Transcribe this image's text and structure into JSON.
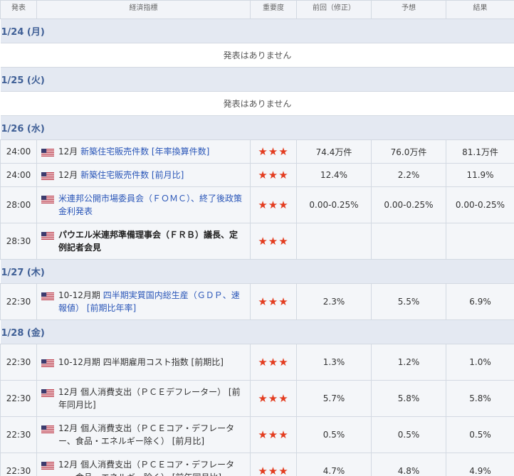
{
  "header": {
    "time": "発表",
    "indicator": "経済指標",
    "importance": "重要度",
    "previous": "前回（修正）",
    "forecast": "予想",
    "result": "結果"
  },
  "colors": {
    "accent_link": "#2a56b8",
    "date_bar": "#e4e9f2",
    "star": "#e33c1f"
  },
  "no_data_text": "発表はありません",
  "sections": [
    {
      "date": "1/24 (月)",
      "events": []
    },
    {
      "date": "1/25 (火)",
      "events": []
    },
    {
      "date": "1/26 (水)",
      "events": [
        {
          "time": "24:00",
          "period": "12月",
          "name": "新築住宅販売件数 [年率換算件数]",
          "style": "link",
          "importance": 3,
          "stars": "★★★",
          "previous": "74.4万件",
          "forecast": "76.0万件",
          "result": "81.1万件"
        },
        {
          "time": "24:00",
          "period": "12月",
          "name": "新築住宅販売件数 [前月比]",
          "style": "link",
          "importance": 3,
          "stars": "★★★",
          "previous": "12.4%",
          "forecast": "2.2%",
          "result": "11.9%"
        },
        {
          "time": "28:00",
          "period": "",
          "name": "米連邦公開市場委員会（ＦＯＭＣ）、終了後政策金利発表",
          "style": "link",
          "importance": 3,
          "stars": "★★★",
          "previous": "0.00-0.25%",
          "forecast": "0.00-0.25%",
          "result": "0.00-0.25%"
        },
        {
          "time": "28:30",
          "period": "",
          "name": "パウエル米連邦準備理事会（ＦＲＢ）議長、定例記者会見",
          "style": "bold",
          "importance": 3,
          "stars": "★★★",
          "previous": "",
          "forecast": "",
          "result": ""
        }
      ]
    },
    {
      "date": "1/27 (木)",
      "events": [
        {
          "time": "22:30",
          "period": "10-12月期",
          "name": "四半期実質国内総生産（ＧＤＰ、速報値） [前期比年率]",
          "style": "link",
          "importance": 3,
          "stars": "★★★",
          "previous": "2.3%",
          "forecast": "5.5%",
          "result": "6.9%"
        }
      ]
    },
    {
      "date": "1/28 (金)",
      "events": [
        {
          "time": "22:30",
          "period": "10-12月期",
          "name": "四半期雇用コスト指数 [前期比]",
          "style": "plain",
          "importance": 3,
          "stars": "★★★",
          "previous": "1.3%",
          "forecast": "1.2%",
          "result": "1.0%"
        },
        {
          "time": "22:30",
          "period": "12月",
          "name": "個人消費支出（ＰＣＥデフレーター） [前年同月比]",
          "style": "plain",
          "importance": 3,
          "stars": "★★★",
          "previous": "5.7%",
          "forecast": "5.8%",
          "result": "5.8%"
        },
        {
          "time": "22:30",
          "period": "12月",
          "name": "個人消費支出（ＰＣＥコア・デフレーター、食品・エネルギー除く） [前月比]",
          "style": "plain",
          "importance": 3,
          "stars": "★★★",
          "previous": "0.5%",
          "forecast": "0.5%",
          "result": "0.5%"
        },
        {
          "time": "22:30",
          "period": "12月",
          "name": "個人消費支出（ＰＣＥコア・デフレーター、食品・エネルギー除く） [前年同月比]",
          "style": "plain",
          "importance": 3,
          "stars": "★★★",
          "previous": "4.7%",
          "forecast": "4.8%",
          "result": "4.9%"
        }
      ]
    }
  ]
}
